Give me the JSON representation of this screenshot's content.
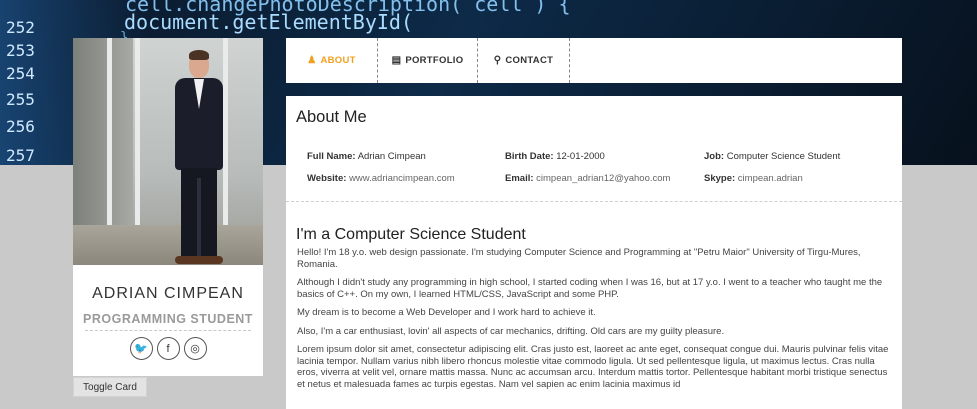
{
  "hero": {
    "code_lines": [
      "cell.changePhotoDescription( cell ) {",
      "document.getElementById(",
      "}"
    ],
    "line_numbers": [
      "252",
      "253",
      "254",
      "255",
      "256",
      "257"
    ]
  },
  "profile": {
    "name": "ADRIAN CIMPEAN",
    "role": "PROGRAMMING STUDENT",
    "socials": [
      {
        "name": "twitter",
        "glyph": "🐦"
      },
      {
        "name": "facebook",
        "glyph": "f"
      },
      {
        "name": "instagram",
        "glyph": "◎"
      }
    ],
    "toggle_label": "Toggle Card"
  },
  "nav": {
    "items": [
      {
        "label": "ABOUT",
        "icon": "user-icon",
        "glyph": "♟",
        "active": true
      },
      {
        "label": "PORTFOLIO",
        "icon": "file-icon",
        "glyph": "▤",
        "active": false
      },
      {
        "label": "CONTACT",
        "icon": "location-pin-icon",
        "glyph": "⚲",
        "active": false
      }
    ]
  },
  "about": {
    "title": "About Me",
    "info": [
      {
        "label": "Full Name:",
        "value": "Adrian Cimpean"
      },
      {
        "label": "Birth Date:",
        "value": "12-01-2000"
      },
      {
        "label": "Job:",
        "value": "Computer Science Student"
      },
      {
        "label": "Website:",
        "value": "www.adriancimpean.com"
      },
      {
        "label": "Email:",
        "value": "cimpean_adrian12@yahoo.com"
      },
      {
        "label": "Skype:",
        "value": "cimpean.adrian"
      }
    ],
    "subtitle": "I'm a Computer Science Student",
    "paragraphs": [
      "Hello! I'm 18 y.o. web design passionate. I'm studying Computer Science and Programming at \"Petru Maior\" University of Tirgu-Mures, Romania.",
      "Although I didn't study any programming in high school, I started coding when I was 16, but at 17 y.o. I went to a teacher who taught me the basics of C++. On my own, I learned HTML/CSS, JavaScript and some PHP.",
      "My dream is to become a Web Developer and I work hard to achieve it.",
      "Also, I'm a car enthusiast, lovin' all aspects of car mechanics, drifting. Old cars are my guilty pleasure.",
      "Lorem ipsum dolor sit amet, consectetur adipiscing elit. Cras justo est, laoreet ac ante eget, consequat congue dui. Mauris pulvinar felis vitae lacinia tempor. Nullam varius nibh libero rhoncus molestie vitae commodo ligula. Ut sed pellentesque ligula, ut maximus lectus. Cras nulla eros, viverra at velit vel, ornare mattis massa. Nunc ac accumsan arcu. Interdum mattis tortor. Pellentesque habitant morbi tristique senectus et netus et malesuada fames ac turpis egestas. Nam vel sapien ac enim lacinia maximus id"
    ]
  },
  "colors": {
    "accent": "#f0a020",
    "page_bg": "#c9c9c9",
    "hero_bg": "#0d2a48"
  }
}
